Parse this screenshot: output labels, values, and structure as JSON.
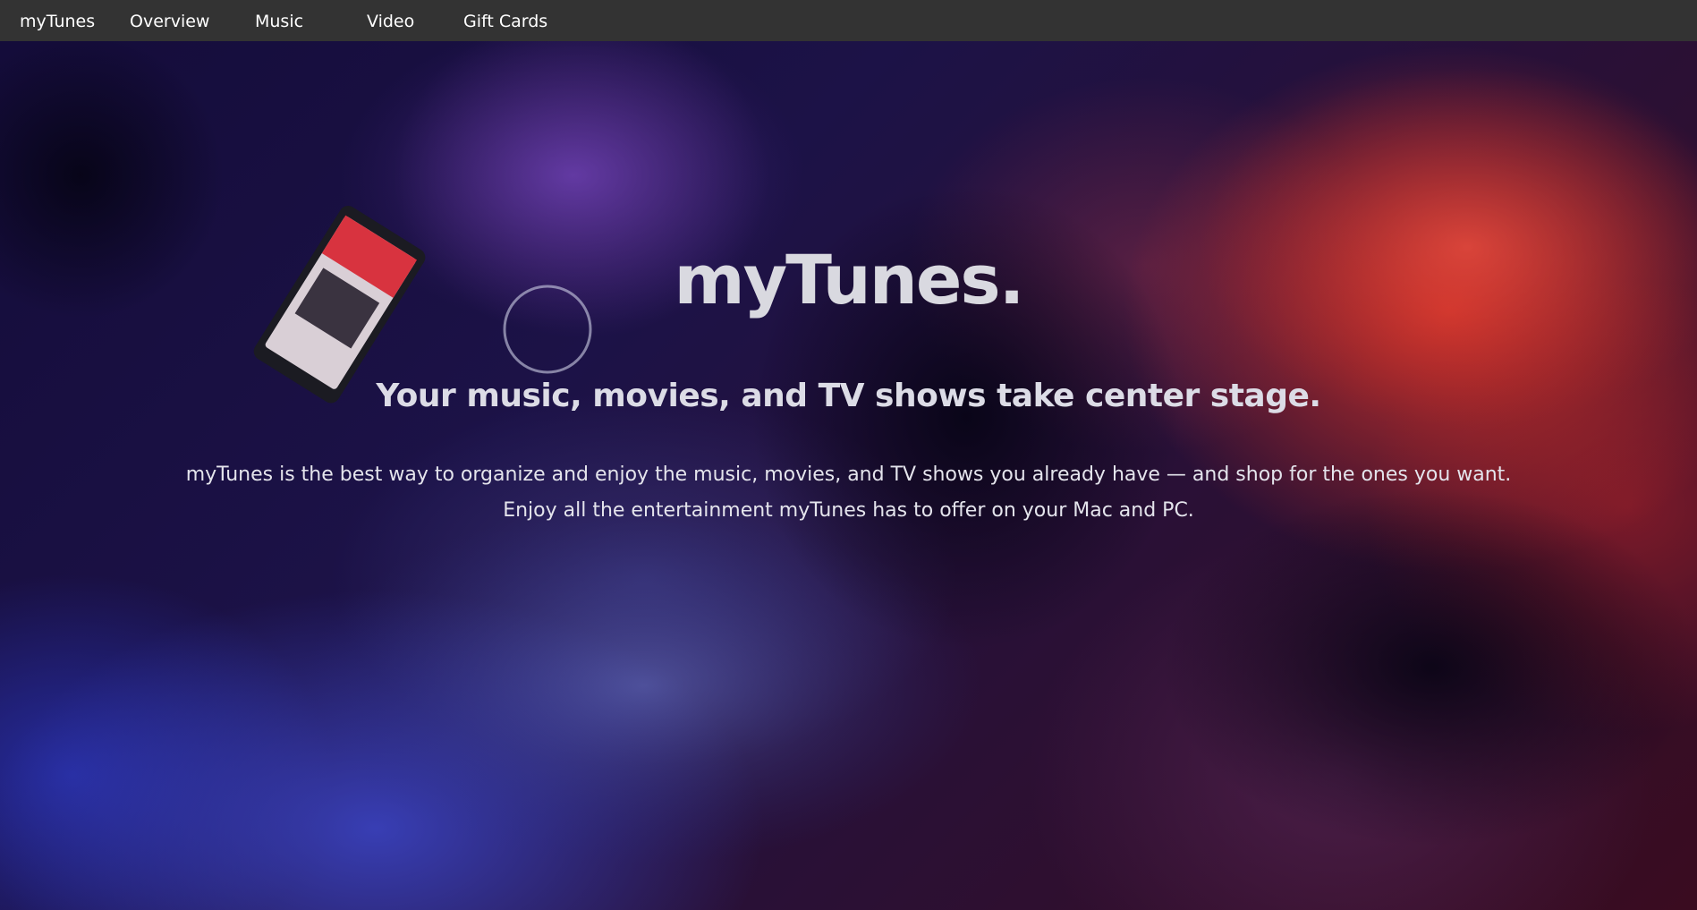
{
  "nav": {
    "items": [
      {
        "label": "myTunes"
      },
      {
        "label": "Overview"
      },
      {
        "label": "Music"
      },
      {
        "label": "Video"
      },
      {
        "label": "Gift Cards"
      }
    ]
  },
  "hero": {
    "title": "myTunes.",
    "subtitle": "Your music, movies, and TV shows take center stage.",
    "description_line1": "myTunes is the best way to organize and enjoy the music, movies, and TV shows you already have — and shop for the ones you want.",
    "description_line2": "Enjoy all the entertainment myTunes has to offer on your Mac and PC."
  },
  "colors": {
    "nav_bg": "#333333",
    "nav_text": "#ffffff",
    "hero_warm": "#d2322a",
    "hero_cool": "#3c46c8"
  }
}
